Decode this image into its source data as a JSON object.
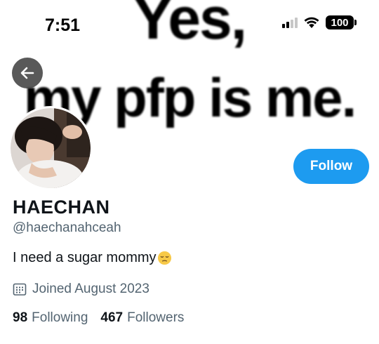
{
  "status_bar": {
    "time": "7:51",
    "battery": "100"
  },
  "banner": {
    "line1": "Yes,",
    "line2": "my pfp is me."
  },
  "profile": {
    "display_name": "HAECHAN",
    "handle": "@haechanahceah",
    "bio": "I need a sugar mommy",
    "joined": "Joined August 2023",
    "following_count": "98",
    "following_label": "Following",
    "followers_count": "467",
    "followers_label": "Followers"
  },
  "actions": {
    "follow_label": "Follow",
    "back_icon": "arrow-left-icon"
  },
  "colors": {
    "accent": "#1d9bf0",
    "secondary_text": "#536471",
    "primary_text": "#0f1419"
  }
}
